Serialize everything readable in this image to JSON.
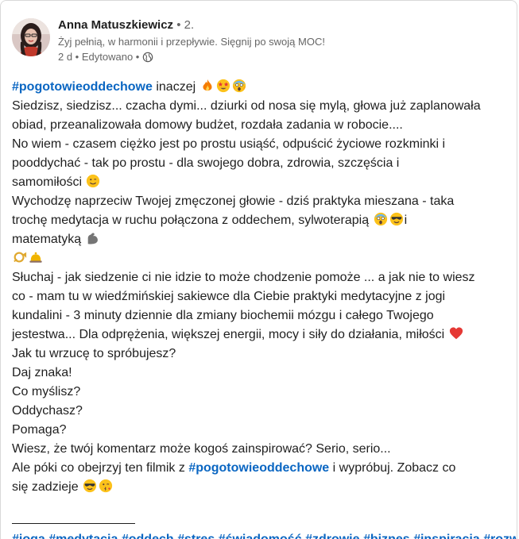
{
  "author": {
    "name": "Anna Matuszkiewicz",
    "degree": " • 2.",
    "headline": "Żyj pełnią, w harmonii i przepływie. Sięgnij po swoją MOC!",
    "time": "2 d • Edytowano •"
  },
  "post": {
    "line1_tag": "#pogotowieoddechowe",
    "line1_text": " inaczej",
    "line2": "Siedzisz, siedzisz... czacha dymi... dziurki od nosa się mylą, głowa już zaplanowała",
    "line3": "obiad, przeanalizowała domowy budżet, rozdała zadania w robocie....",
    "line4": "No wiem - czasem ciężko jest po prostu usiąść, odpuścić życiowe rozkminki i",
    "line5": "pooddychać - tak po prostu - dla swojego dobra, zdrowia, szczęścia i",
    "line6": "samomiłości",
    "line7": "Wychodzę naprzeciw Twojej zmęczonej głowie - dziś praktyka mieszana - taka",
    "line8": "trochę medytacja w ruchu połączona z oddechem, sylwoterapią",
    "line8_end": "i",
    "line9": "matematyką",
    "line11": "Słuchaj - jak siedzenie ci nie idzie to może chodzenie pomoże ... a jak nie to wiesz",
    "line12": "co - mam tu w wiedźmińskiej sakiewce dla Ciebie praktyki medytacyjne z jogi",
    "line13": "kundalini - 3 minuty dziennie dla zmiany biochemii mózgu i całego Twojego",
    "line14": "jestestwa... Dla odprężenia, większej energii, mocy i siły do działania, miłości",
    "line15": "Jak tu wrzucę to spróbujesz?",
    "line16": "Daj znaka!",
    "line17": "Co myślisz?",
    "line18": "Oddychasz?",
    "line19": "Pomaga?",
    "line20": "Wiesz, że twój komentarz może kogoś zainspirować? Serio, serio...",
    "line21_pre": "Ale póki co obejrzyj ten filmik z ",
    "line21_tag": "#pogotowieoddechowe",
    "line21_post": " i wypróbuj. Zobacz co",
    "line22": "się zadzieje"
  },
  "hashtags": "#joga #medytacja #oddech #stres #świadomość #zdrowie #biznes #inspiracja #rozwoj",
  "emoji": {
    "fire": "fire-emoji",
    "star_eyes": "star-struck-emoji",
    "scream": "screaming-face-emoji",
    "wink": "winking-face-emoji",
    "cool": "sunglasses-face-emoji",
    "muscle": "flexed-biceps-emoji",
    "hearts": "heart-emoji",
    "kiss": "face-blowing-kiss-emoji"
  },
  "colors": {
    "link": "#0a66c2",
    "text": "#1f1f1f",
    "muted": "#666666"
  }
}
